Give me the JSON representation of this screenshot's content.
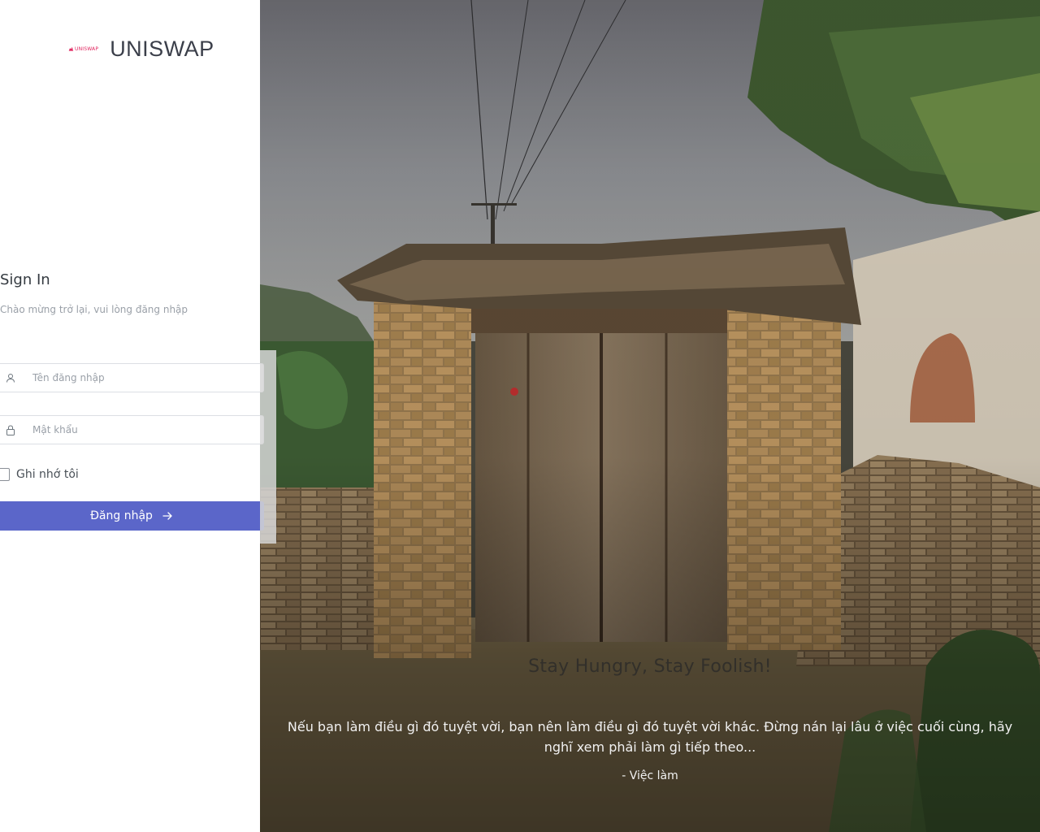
{
  "brand": {
    "logo_text": "UNISWAP",
    "name": "UNISWAP",
    "accent_color": "#e0245e"
  },
  "signin": {
    "title": "Sign In",
    "subtitle": "Chào mừng trở lại, vui lòng đăng nhập"
  },
  "form": {
    "username_placeholder": "Tên đăng nhập",
    "password_placeholder": "Mật khẩu",
    "username_icon": "user-icon",
    "password_icon": "lock-icon",
    "remember_label": "Ghi nhớ tôi",
    "remember_checked": false,
    "login_label": "Đăng nhập",
    "login_icon": "arrow-right-icon",
    "button_color": "#5b66c9"
  },
  "hero": {
    "quote_title": "Stay Hungry, Stay Foolish!",
    "quote_body": "Nếu bạn làm điều gì đó tuyệt vời, bạn nên làm điều gì đó tuyệt vời khác. Đừng nán lại lâu ở việc cuối cùng, hãy nghĩ xem phải làm gì tiếp theo...",
    "quote_author": "- Việc làm"
  }
}
